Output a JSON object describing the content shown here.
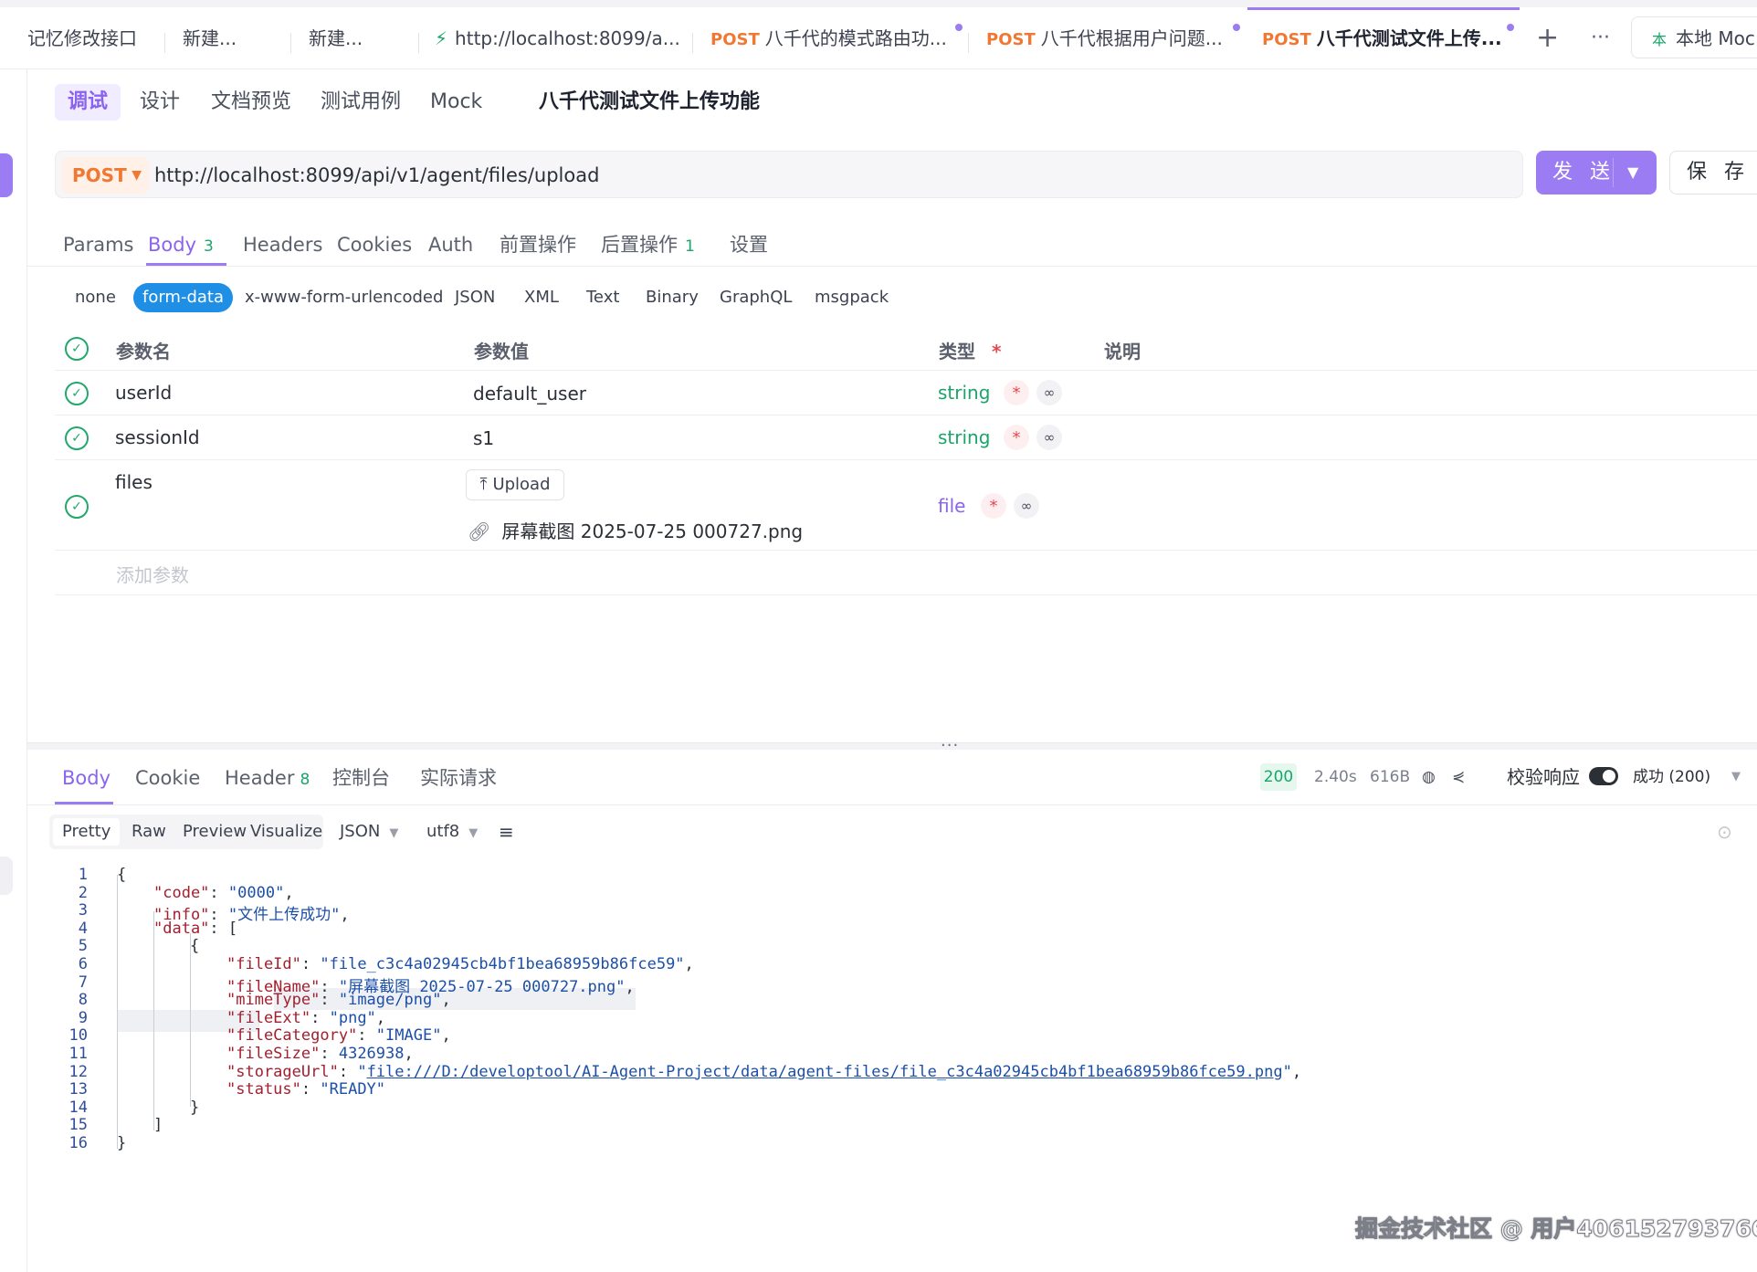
{
  "tabs": [
    {
      "label": "记忆修改接口"
    },
    {
      "label": "新建..."
    },
    {
      "label": "新建..."
    },
    {
      "label": "http://localhost:8099/a..."
    },
    {
      "method": "POST",
      "label": "八千代的模式路由功..."
    },
    {
      "method": "POST",
      "label": "八千代根据用户问题..."
    },
    {
      "method": "POST",
      "label": "八千代测试文件上传..."
    }
  ],
  "tab_actions": {
    "add": "+",
    "more": "···"
  },
  "environment": {
    "label": "本地 Moc"
  },
  "modes": [
    "调试",
    "设计",
    "文档预览",
    "测试用例",
    "Mock"
  ],
  "api_name": "八千代测试文件上传功能",
  "request": {
    "method": "POST",
    "url": "http://localhost:8099/api/v1/agent/files/upload",
    "send_label": "发 送",
    "save_label": "保 存"
  },
  "request_tabs": [
    {
      "label": "Params"
    },
    {
      "label": "Body",
      "count": "3"
    },
    {
      "label": "Headers"
    },
    {
      "label": "Cookies"
    },
    {
      "label": "Auth"
    },
    {
      "label": "前置操作"
    },
    {
      "label": "后置操作",
      "count": "1"
    },
    {
      "label": "设置"
    }
  ],
  "body_types": [
    "none",
    "form-data",
    "x-www-form-urlencoded",
    "JSON",
    "XML",
    "Text",
    "Binary",
    "GraphQL",
    "msgpack"
  ],
  "params_table": {
    "headers": {
      "name": "参数名",
      "value": "参数值",
      "type": "类型",
      "required_mark": "*",
      "desc": "说明"
    },
    "rows": [
      {
        "name": "userId",
        "value": "default_user",
        "type": "string"
      },
      {
        "name": "sessionId",
        "value": "s1",
        "type": "string"
      },
      {
        "name": "files",
        "upload_label": "Upload",
        "file_name": "屏幕截图 2025-07-25 000727.png",
        "type": "file"
      }
    ],
    "add_placeholder": "添加参数",
    "required_mark": "*"
  },
  "response_tabs": [
    {
      "label": "Body"
    },
    {
      "label": "Cookie"
    },
    {
      "label": "Header",
      "count": "8"
    },
    {
      "label": "控制台"
    },
    {
      "label": "实际请求"
    }
  ],
  "response_meta": {
    "status_code": "200",
    "time": "2.40s",
    "size": "616B",
    "validate_label": "校验响应",
    "result": "成功 (200)"
  },
  "view_modes": [
    "Pretty",
    "Raw",
    "Preview",
    "Visualize"
  ],
  "format": "JSON",
  "encoding": "utf8",
  "response_lines": {
    "l1": "{",
    "code_key": "\"code\"",
    "code_val": "\"0000\"",
    "info_key": "\"info\"",
    "info_val": "\"文件上传成功\"",
    "data_key": "\"data\"",
    "fileId_key": "\"fileId\"",
    "fileId_val": "\"file_c3c4a02945cb4bf1bea68959b86fce59\"",
    "fileName_key": "\"fileName\"",
    "fileName_val": "\"屏幕截图 2025-07-25 000727.png\"",
    "mimeType_key": "\"mimeType\"",
    "mimeType_val": "\"image/png\"",
    "fileExt_key": "\"fileExt\"",
    "fileExt_val": "\"png\"",
    "fileCategory_key": "\"fileCategory\"",
    "fileCategory_val": "\"IMAGE\"",
    "fileSize_key": "\"fileSize\"",
    "fileSize_val": "4326938",
    "storageUrl_key": "\"storageUrl\"",
    "storageUrl_link": "file:///D:/developtool/AI-Agent-Project/data/agent-files/file_c3c4a02945cb4bf1bea68959b86fce59.png",
    "status_key": "\"status\"",
    "status_val": "\"READY\""
  },
  "line_numbers": [
    "1",
    "2",
    "3",
    "4",
    "5",
    "6",
    "7",
    "8",
    "9",
    "10",
    "11",
    "12",
    "13",
    "14",
    "15",
    "16"
  ],
  "watermark": "掘金技术社区 @ 用户406152793766"
}
